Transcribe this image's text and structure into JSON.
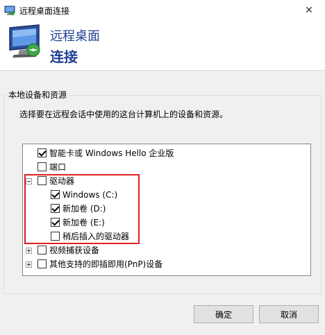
{
  "window": {
    "title": "远程桌面连接",
    "close_glyph": "✕"
  },
  "banner": {
    "line1": "远程桌面",
    "line2": "连接"
  },
  "group": {
    "legend": "本地设备和资源",
    "description": "选择要在远程会话中使用的这台计算机上的设备和资源。"
  },
  "tree_items": [
    {
      "label": "智能卡或 Windows Hello 企业版",
      "checked": true,
      "expander": "none",
      "level": 0
    },
    {
      "label": "端口",
      "checked": false,
      "expander": "none",
      "level": 0
    },
    {
      "label": "驱动器",
      "checked": false,
      "expander": "minus",
      "level": 0
    },
    {
      "label": "Windows (C:)",
      "checked": true,
      "expander": "none",
      "level": 1
    },
    {
      "label": "新加卷 (D:)",
      "checked": true,
      "expander": "none",
      "level": 1
    },
    {
      "label": "新加卷 (E:)",
      "checked": true,
      "expander": "none",
      "level": 1
    },
    {
      "label": "稍后插入的驱动器",
      "checked": false,
      "expander": "none",
      "level": 1
    },
    {
      "label": "视频捕获设备",
      "checked": false,
      "expander": "plus",
      "level": 0
    },
    {
      "label": "其他支持的即插即用(PnP)设备",
      "checked": false,
      "expander": "plus",
      "level": 0
    }
  ],
  "buttons": {
    "ok": "确定",
    "cancel": "取消"
  },
  "colors": {
    "banner_text": "#1f3f93",
    "highlight": "#e02020"
  }
}
